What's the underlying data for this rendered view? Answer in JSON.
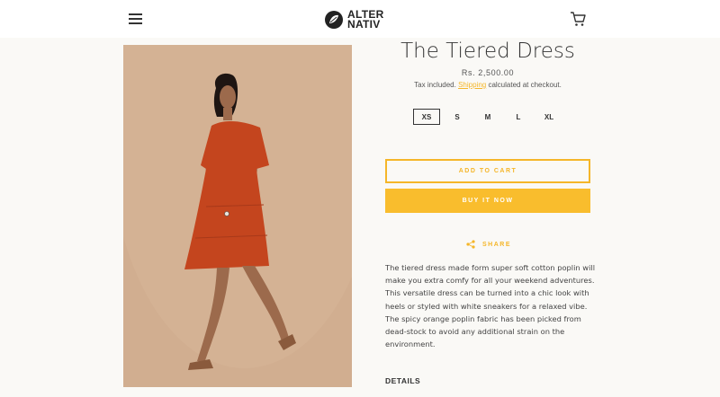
{
  "header": {
    "menu_icon": "hamburger-menu-icon",
    "logo": {
      "line1": "ALTER",
      "line2": "NATIV"
    },
    "cart_icon": "cart-icon"
  },
  "product": {
    "title": "The Tiered Dress",
    "price": "Rs. 2,500.00",
    "tax_prefix": "Tax included.",
    "tax_link": "Shipping",
    "tax_suffix": "calculated at checkout.",
    "sizes": [
      "XS",
      "S",
      "M",
      "L",
      "XL"
    ],
    "selected_size": "XS",
    "add_to_cart": "ADD TO CART",
    "buy_now": "BUY IT NOW",
    "share": "SHARE",
    "description": "The tiered dress made form super soft cotton poplin will make you extra comfy for all your weekend adventures. This versatile dress can be turned into a chic look with heels or styled with white sneakers for a relaxed vibe. The spicy orange poplin fabric has been picked from dead-stock to avoid any additional strain on the environment.",
    "details_heading": "DETAILS"
  },
  "colors": {
    "accent": "#f5b629",
    "image_background": "#d1ae90",
    "dress": "#c4451e"
  }
}
